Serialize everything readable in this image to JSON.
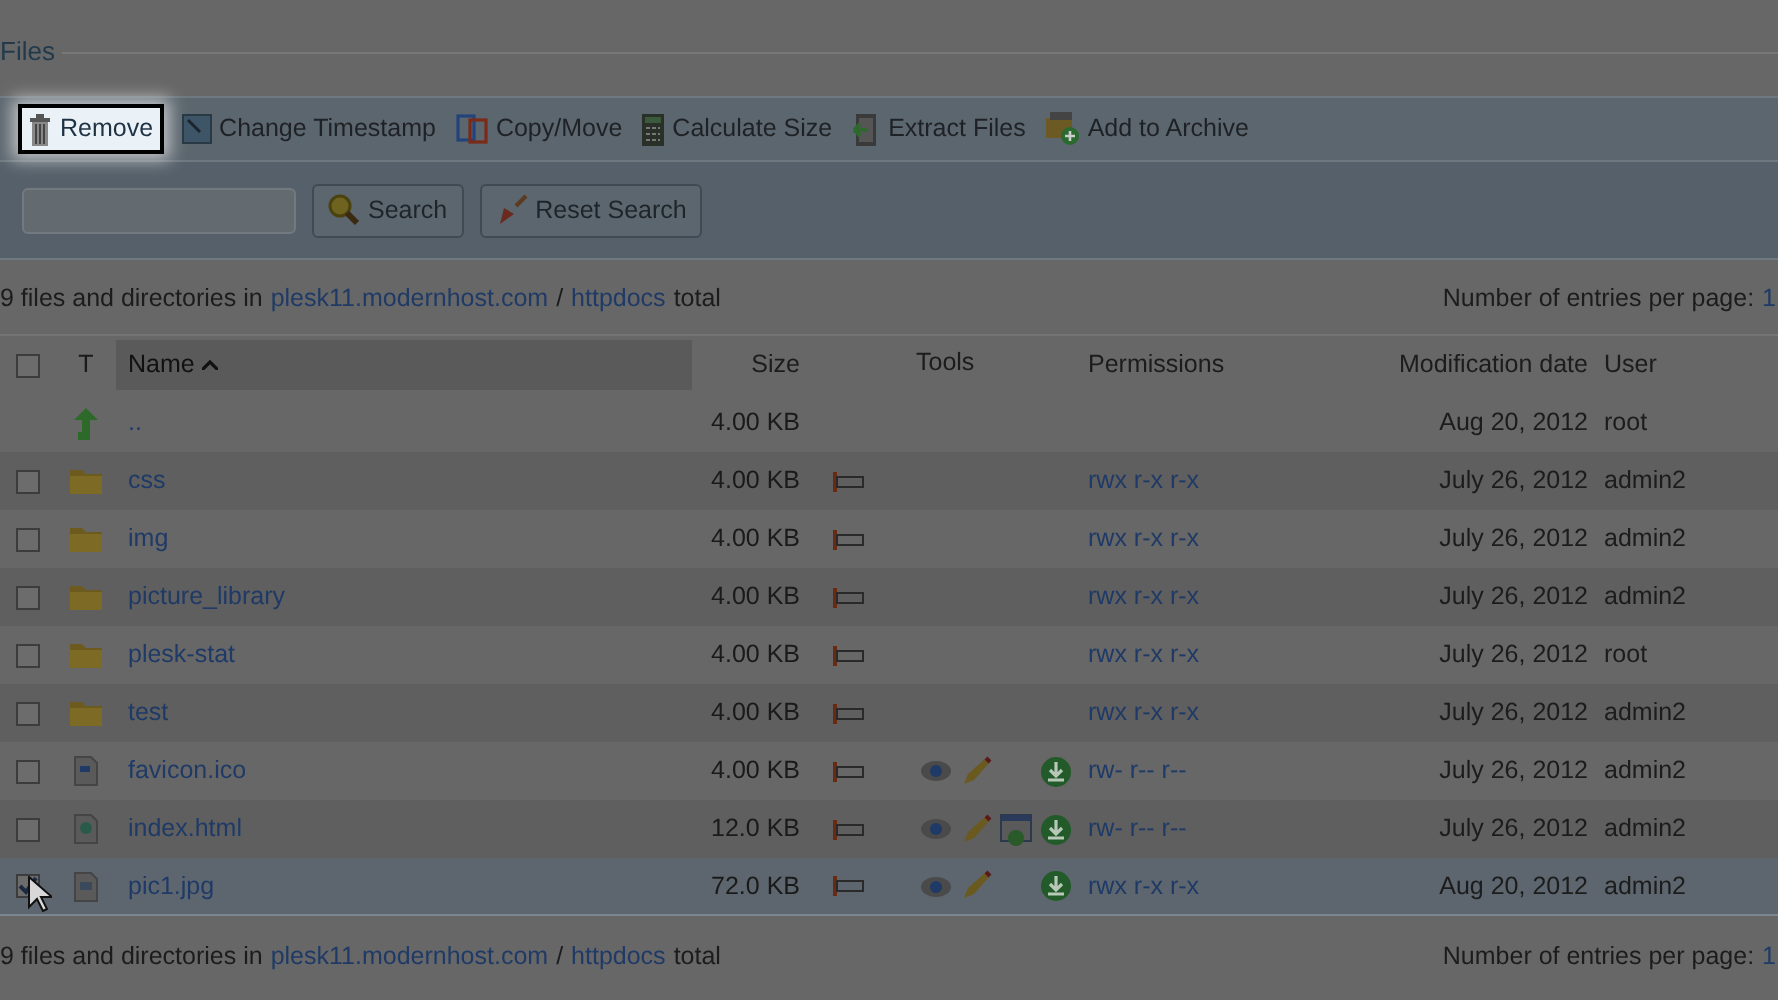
{
  "title": "Files",
  "toolbar": [
    {
      "kind": "remove",
      "label": "Remove",
      "highlighted": true
    },
    {
      "kind": "timestamp",
      "label": "Change Timestamp",
      "highlighted": false
    },
    {
      "kind": "copy",
      "label": "Copy/Move",
      "highlighted": false
    },
    {
      "kind": "calculate",
      "label": "Calculate Size",
      "highlighted": false
    },
    {
      "kind": "extract",
      "label": "Extract Files",
      "highlighted": false
    },
    {
      "kind": "archive",
      "label": "Add to Archive",
      "highlighted": false
    }
  ],
  "search": {
    "buttons": [
      {
        "kind": "search",
        "label": "Search"
      },
      {
        "kind": "reset",
        "label": "Reset Search"
      }
    ]
  },
  "summary": {
    "text": "9 files and directories in",
    "host": "plesk11.modernhost.com",
    "separator": "/",
    "folder": "httpdocs",
    "suffix": "total"
  },
  "entries_per_page": {
    "label": "Number of entries per page:",
    "value": "1"
  },
  "columns": {
    "type": "T",
    "name": "Name",
    "size": "Size",
    "tools": "Tools",
    "permissions": "Permissions",
    "date": "Modification date",
    "user": "User"
  },
  "header_checked": false,
  "rows": [
    {
      "kind": "parent",
      "name": "..",
      "size": "4.00 KB",
      "properties": false,
      "tools": [],
      "permissions": "",
      "date": "Aug 20, 2012",
      "user": "root",
      "selected": false
    },
    {
      "kind": "folder",
      "checked": false,
      "name": "css",
      "size": "4.00 KB",
      "properties": true,
      "tools": [],
      "permissions": "rwx r-x r-x",
      "date": "July 26, 2012",
      "user": "admin2",
      "selected": false
    },
    {
      "kind": "folder",
      "checked": false,
      "name": "img",
      "size": "4.00 KB",
      "properties": true,
      "tools": [],
      "permissions": "rwx r-x r-x",
      "date": "July 26, 2012",
      "user": "admin2",
      "selected": false
    },
    {
      "kind": "folder",
      "checked": false,
      "name": "picture_library",
      "size": "4.00 KB",
      "properties": true,
      "tools": [],
      "permissions": "rwx r-x r-x",
      "date": "July 26, 2012",
      "user": "admin2",
      "selected": false
    },
    {
      "kind": "folder",
      "checked": false,
      "name": "plesk-stat",
      "size": "4.00 KB",
      "properties": true,
      "tools": [],
      "permissions": "rwx r-x r-x",
      "date": "July 26, 2012",
      "user": "root",
      "selected": false
    },
    {
      "kind": "folder",
      "checked": false,
      "name": "test",
      "size": "4.00 KB",
      "properties": true,
      "tools": [],
      "permissions": "rwx r-x r-x",
      "date": "July 26, 2012",
      "user": "admin2",
      "selected": false
    },
    {
      "kind": "icon-file",
      "checked": false,
      "name": "favicon.ico",
      "size": "4.00 KB",
      "properties": true,
      "tools": [
        {
          "kind": "view"
        },
        {
          "kind": "edit"
        },
        {
          "kind": "download"
        }
      ],
      "permissions": "rw- r-- r--",
      "date": "July 26, 2012",
      "user": "admin2",
      "selected": false
    },
    {
      "kind": "web-file",
      "checked": false,
      "name": "index.html",
      "size": "12.0 KB",
      "properties": true,
      "tools": [
        {
          "kind": "view"
        },
        {
          "kind": "edit"
        },
        {
          "kind": "preview"
        },
        {
          "kind": "download"
        }
      ],
      "permissions": "rw- r-- r--",
      "date": "July 26, 2012",
      "user": "admin2",
      "selected": false
    },
    {
      "kind": "image-file",
      "checked": true,
      "name": "pic1.jpg",
      "size": "72.0 KB",
      "properties": true,
      "tools": [
        {
          "kind": "view"
        },
        {
          "kind": "edit"
        },
        {
          "kind": "download"
        }
      ],
      "permissions": "rwx r-x r-x",
      "date": "Aug 20, 2012",
      "user": "admin2",
      "selected": true
    }
  ],
  "footer": {
    "text": "9 files and directories in",
    "host": "plesk11.modernhost.com",
    "separator": "/",
    "folder": "httpdocs",
    "suffix": "total",
    "entries_label": "Number of entries per page:",
    "entries_value": "1"
  }
}
